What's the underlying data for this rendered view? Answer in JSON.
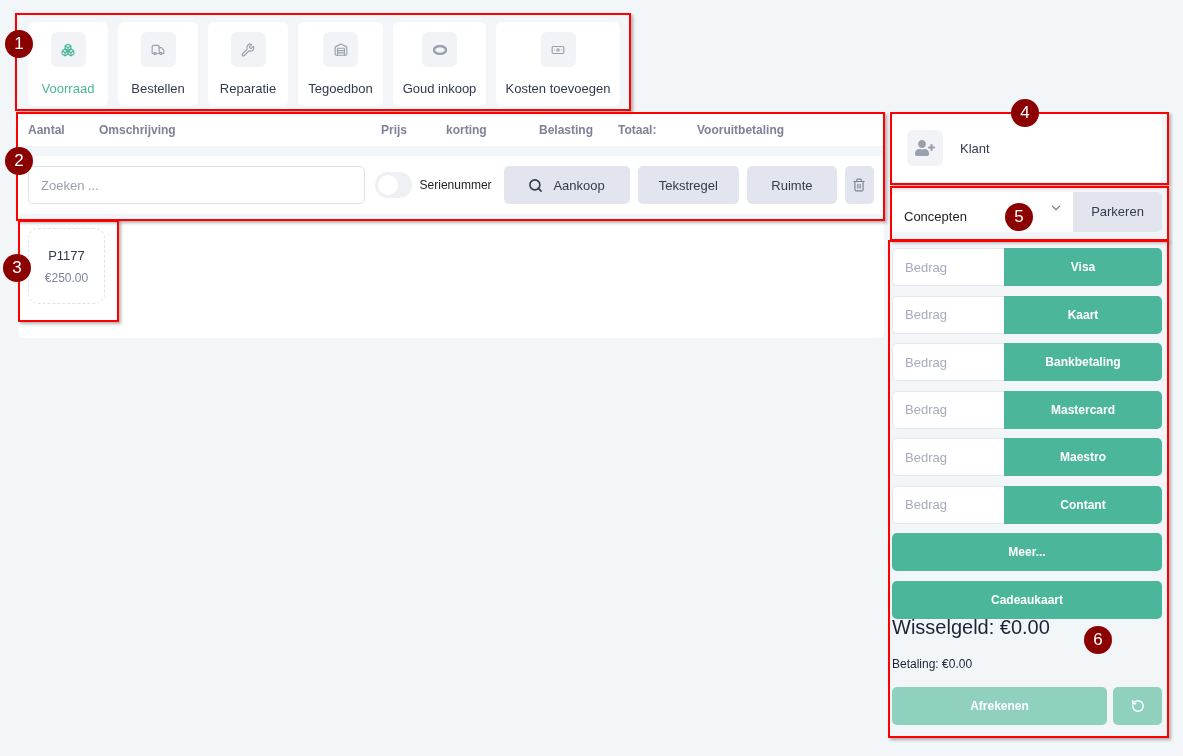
{
  "tabs": [
    {
      "label": "Voorraad",
      "selected": true
    },
    {
      "label": "Bestellen",
      "selected": false
    },
    {
      "label": "Reparatie",
      "selected": false
    },
    {
      "label": "Tegoedbon",
      "selected": false
    },
    {
      "label": "Goud inkoop",
      "selected": false
    },
    {
      "label": "Kosten toevoegen",
      "selected": false
    }
  ],
  "table": {
    "columns": [
      "Aantal",
      "Omschrijving",
      "Prijs",
      "korting",
      "Belasting",
      "Totaal:",
      "Vooruitbetaling"
    ]
  },
  "toolbar": {
    "search": {
      "placeholder": "Zoeken ..."
    },
    "serial_toggle": {
      "label": "Serienummer",
      "checked": false
    },
    "buttons": [
      "Aankoop",
      "Tekstregel",
      "Ruimte"
    ]
  },
  "products": [
    {
      "code": "P1177",
      "price": "€250.00"
    }
  ],
  "customer": {
    "label": "Klant"
  },
  "concepts": {
    "value": "Concepten",
    "button": "Parkeren"
  },
  "payments": [
    {
      "placeholder": "Bedrag",
      "method": "Visa"
    },
    {
      "placeholder": "Bedrag",
      "method": "Kaart"
    },
    {
      "placeholder": "Bedrag",
      "method": "Bankbetaling"
    },
    {
      "placeholder": "Bedrag",
      "method": "Mastercard"
    },
    {
      "placeholder": "Bedrag",
      "method": "Maestro"
    },
    {
      "placeholder": "Bedrag",
      "method": "Contant"
    }
  ],
  "extra_buttons": [
    "Meer...",
    "Cadeaukaart"
  ],
  "change": "Wisselgeld: €0.00",
  "payment_total": "Betaling: €0.00",
  "checkout": {
    "label": "Afrekenen",
    "disabled": true
  },
  "annotations": [
    "1",
    "2",
    "3",
    "4",
    "5",
    "6"
  ]
}
